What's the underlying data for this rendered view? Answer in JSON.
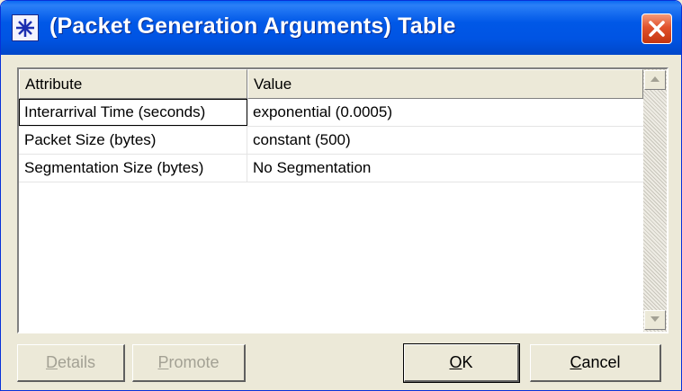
{
  "window": {
    "title": "(Packet Generation Arguments) Table",
    "accent": "#0054e3",
    "close_color": "#e1522c"
  },
  "icons": {
    "app": "table-star-icon",
    "close": "close-icon",
    "scroll_up": "arrow-up-icon",
    "scroll_down": "arrow-down-icon"
  },
  "table": {
    "columns": [
      "Attribute",
      "Value"
    ],
    "rows": [
      {
        "attribute": "Interarrival Time (seconds)",
        "value": "exponential (0.0005)"
      },
      {
        "attribute": "Packet Size (bytes)",
        "value": "constant (500)"
      },
      {
        "attribute": "Segmentation Size (bytes)",
        "value": "No Segmentation"
      }
    ]
  },
  "buttons": {
    "details": {
      "mnemonic": "D",
      "rest": "etails",
      "enabled": false
    },
    "promote": {
      "mnemonic": "P",
      "rest": "romote",
      "enabled": false
    },
    "ok": {
      "mnemonic": "O",
      "rest": "K",
      "enabled": true
    },
    "cancel": {
      "mnemonic": "C",
      "rest": "ancel",
      "enabled": true
    }
  }
}
